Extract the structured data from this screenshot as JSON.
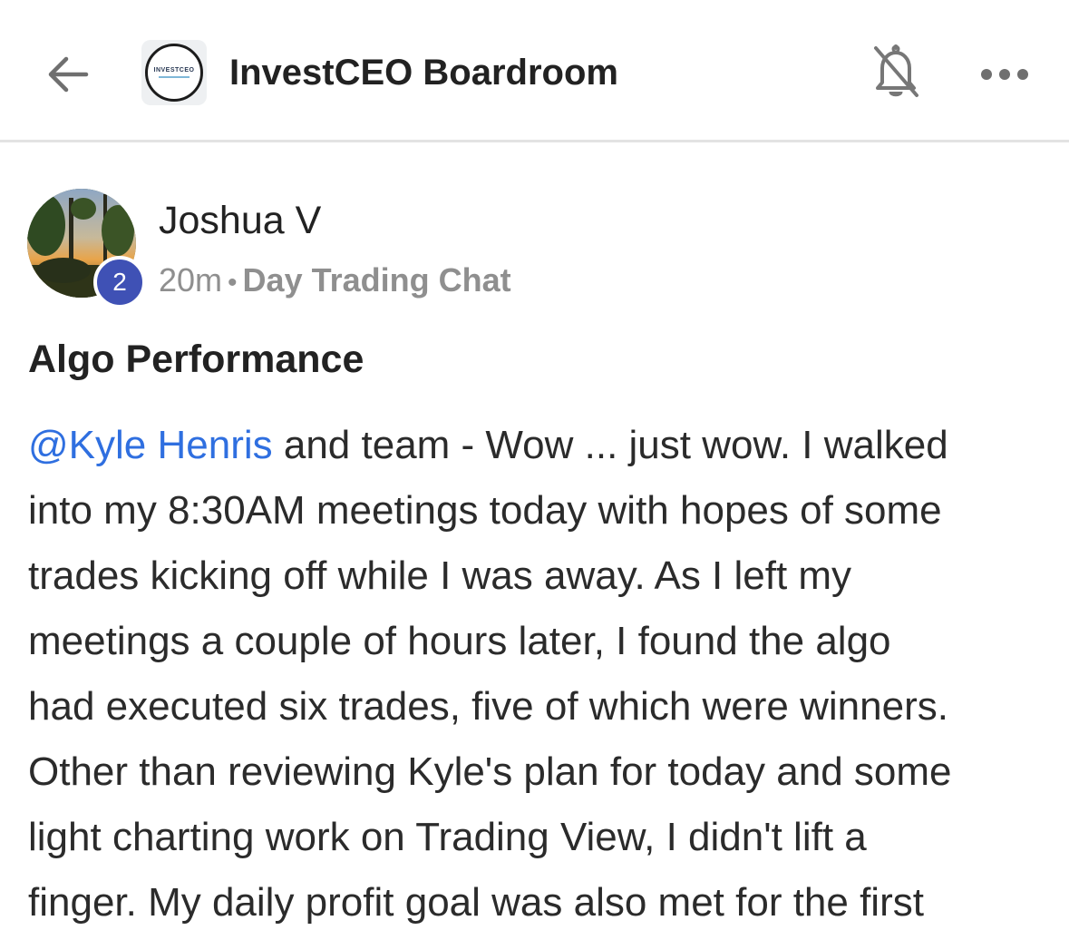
{
  "header": {
    "title": "InvestCEO Boardroom",
    "logo_text": "INVESTCEO",
    "back_icon": "arrow-left-icon",
    "mute_icon": "bell-off-icon",
    "more_icon": "more-horizontal-icon"
  },
  "post": {
    "author": "Joshua V",
    "badge": "2",
    "time": "20m",
    "separator": "•",
    "channel": "Day Trading Chat",
    "title": "Algo Performance",
    "mention": "@Kyle Henris",
    "body_lines": [
      " and team - Wow ... just wow. I walked",
      "into my 8:30AM meetings today with hopes of some",
      "trades kicking off while I was away. As I left my",
      "meetings a couple of hours later, I found the algo",
      "had executed six trades, five of which were winners.",
      "Other than reviewing Kyle's plan for today and some",
      "light charting work on Trading View, I didn't lift a",
      "finger. My daily profit goal was also met for the first"
    ]
  },
  "colors": {
    "mention": "#2f6fe0",
    "badge": "#3f51b5",
    "meta": "#8f8f8f"
  }
}
